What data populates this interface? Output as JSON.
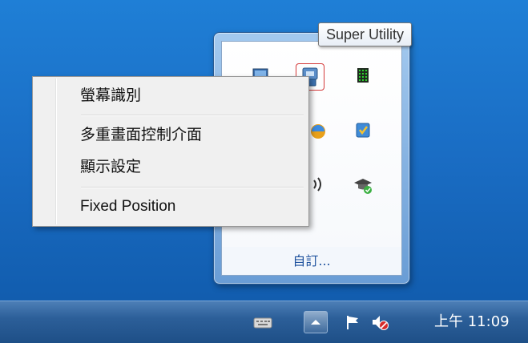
{
  "tooltip": {
    "text": "Super Utility"
  },
  "context_menu": {
    "items": [
      {
        "label": "螢幕識別"
      },
      {
        "label": "多重畫面控制介面"
      },
      {
        "label": "顯示設定"
      },
      {
        "label": "Fixed Position"
      }
    ]
  },
  "tray_popup": {
    "customize_label": "自訂...",
    "icons": [
      "monitor-icon",
      "super-utility-icon",
      "green-grid-icon",
      "browser-icon",
      "shield-check-icon",
      "speaker-icon",
      "graduation-cap-icon"
    ]
  },
  "taskbar": {
    "clock": "上午 11:09",
    "icons": [
      "keyboard-icon",
      "show-hidden-icons-button",
      "action-center-flag-icon",
      "volume-muted-icon"
    ]
  },
  "colors": {
    "desktop": "#1a6dc4",
    "taskbar": "#2c5f99",
    "highlight_border": "#d43a3a",
    "link": "#1b4f9c"
  }
}
